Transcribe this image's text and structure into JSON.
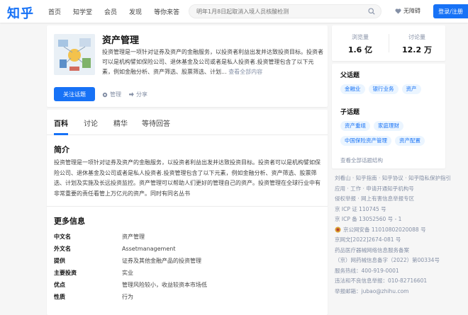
{
  "header": {
    "logo": "知乎",
    "nav": [
      "首页",
      "知学堂",
      "会员",
      "发现",
      "等你来答"
    ],
    "search_placeholder": "明年1月8日起取消入境人员核酸检测",
    "no_barrier": "无障碍",
    "login_label": "登录/注册"
  },
  "topic": {
    "title": "资产管理",
    "description": "投资管理是一项针对证券及资产的金融服务，以投资者利益出发并达致投资目标。投资者可以是机构譬如保险公司、退休基金及公司或者是私人投资者.投资管理包含了以下元素，例如金融分析、资产筛选、股票筛选、计划...",
    "more_label": "查看全部内容",
    "follow_label": "关注话题",
    "manage_label": "管理",
    "share_label": "分享"
  },
  "stats": [
    {
      "label": "浏览量",
      "value": "1.6 亿"
    },
    {
      "label": "讨论量",
      "value": "12.2 万"
    }
  ],
  "related": {
    "parent_label": "父话题",
    "parent_tags": [
      "金融业",
      "银行业务",
      "资产"
    ],
    "child_label": "子话题",
    "child_tags": [
      "资产重组",
      "家庭理财",
      "中国保险资产管理",
      "资产配置"
    ],
    "structure_link": "查看全部话题结构"
  },
  "footer": [
    "刘看山 · 知乎指南 · 知乎协议 · 知乎隐私保护指引",
    "应用 · 工作 · 申请开通知乎机构号",
    "侵权举报 · 网上有害信息举报专区",
    "京 ICP 证 110745 号",
    "京 ICP 备 13052560 号 - 1",
    "京公网安备 11010802020088 号",
    "京网文[2022]2674-081 号",
    "药品医疗器械网络信息服务备案",
    "（京）网药械信息备字（2022）第00334号",
    "服务热线：400-919-0001",
    "违法和不良信息举报：010-82716601",
    "举报邮箱：jubao@zhihu.com"
  ],
  "tabs": [
    "百科",
    "讨论",
    "精华",
    "等待回答"
  ],
  "intro": {
    "heading": "简介",
    "text": "投资管理是一项针对证券及资产的金融服务，以投资者利益出发并达致投资目标。投资者可以是机构譬如保险公司、退休基金及公司或者是私人投资者.投资管理包含了以下元素，例如金融分析、资产筛选、股票筛选、计划及实施及长远投资监控。资产管理可以帮助人们更好的管理自己的资产。投资管理在全球行业中有非常重要的责任看管上万亿元的资产。同时有同名丛书"
  },
  "more_info": {
    "heading": "更多信息",
    "rows": [
      {
        "key": "中文名",
        "value": "资产管理"
      },
      {
        "key": "外文名",
        "value": "Assetmanagement"
      },
      {
        "key": "提供",
        "value": "证券及其他金融产品的投资管理"
      },
      {
        "key": "主要投资",
        "value": "实业"
      },
      {
        "key": "优点",
        "value": "管理风险较小，收益较资本市场低"
      },
      {
        "key": "性质",
        "value": "行为"
      }
    ]
  },
  "colors": {
    "accent": "#1772f6",
    "tag_bg": "#ebf5ff",
    "muted": "#8590a6"
  }
}
